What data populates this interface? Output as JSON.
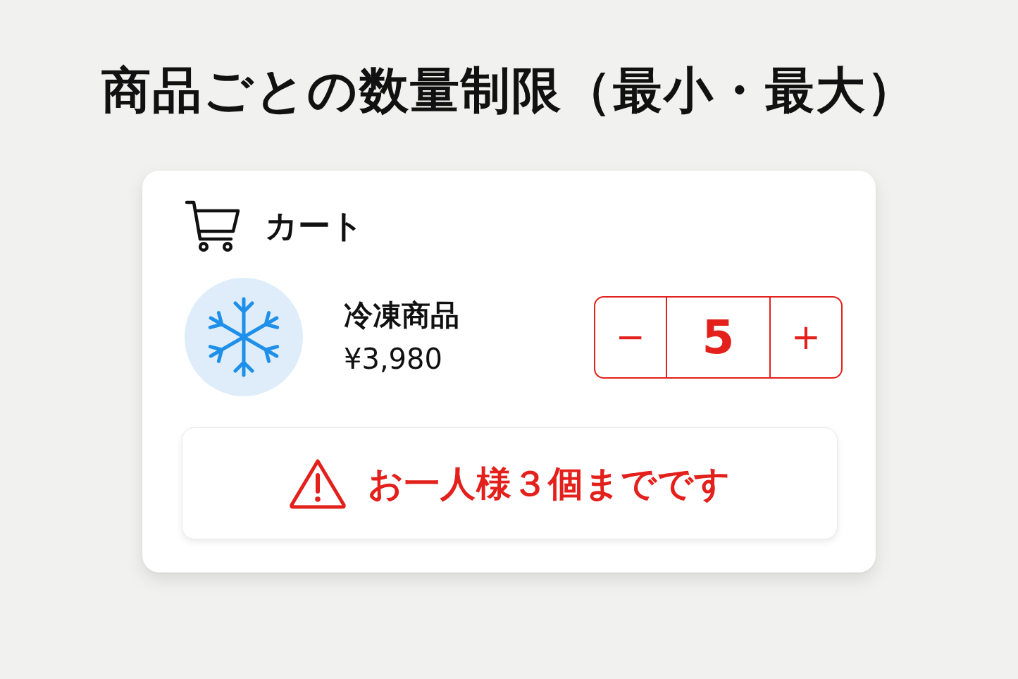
{
  "title": "商品ごとの数量制限（最小・最大）",
  "cart": {
    "title": "カート",
    "item": {
      "name": "冷凍商品",
      "price": "¥3,980",
      "quantity": {
        "decrement": "−",
        "value": "5",
        "increment": "+",
        "invalid": true
      }
    },
    "alert": {
      "kind": "warning",
      "message": "お一人様３個までです"
    }
  }
}
